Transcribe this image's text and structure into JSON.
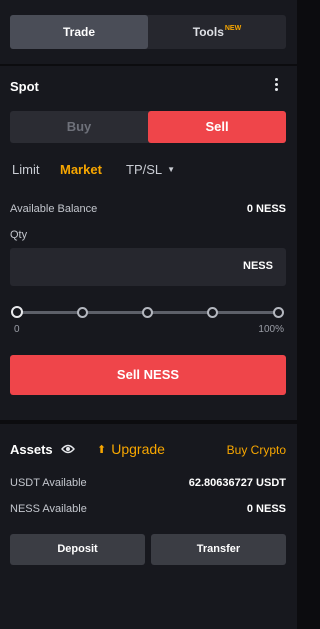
{
  "top_tabs": {
    "trade_label": "Trade",
    "tools_label": "Tools",
    "tools_badge": "NEW",
    "active": "Trade"
  },
  "spot": {
    "title": "Spot",
    "buy_label": "Buy",
    "sell_label": "Sell",
    "active_side": "Sell"
  },
  "order_types": {
    "limit": "Limit",
    "market": "Market",
    "tpsl": "TP/SL",
    "active": "Market"
  },
  "balance": {
    "label": "Available Balance",
    "value": "0 NESS"
  },
  "qty": {
    "label": "Qty",
    "unit": "NESS",
    "value": ""
  },
  "slider": {
    "min_label": "0",
    "max_label": "100%",
    "value_percent": 0,
    "steps_percent": [
      0,
      25,
      50,
      75,
      100
    ]
  },
  "submit_label": "Sell NESS",
  "assets": {
    "title": "Assets",
    "upgrade_label": "Upgrade",
    "buy_crypto_label": "Buy Crypto",
    "rows": [
      {
        "label": "USDT Available",
        "value": "62.80636727 USDT"
      },
      {
        "label": "NESS Available",
        "value": "0 NESS"
      }
    ],
    "deposit_label": "Deposit",
    "transfer_label": "Transfer"
  },
  "colors": {
    "accent": "#f7a600",
    "sell": "#ef454a",
    "panel": "#17181e",
    "background": "#0c0c0f"
  },
  "icons": [
    "more-vertical-icon",
    "eye-icon",
    "upgrade-arrow-icon",
    "caret-down-icon"
  ]
}
